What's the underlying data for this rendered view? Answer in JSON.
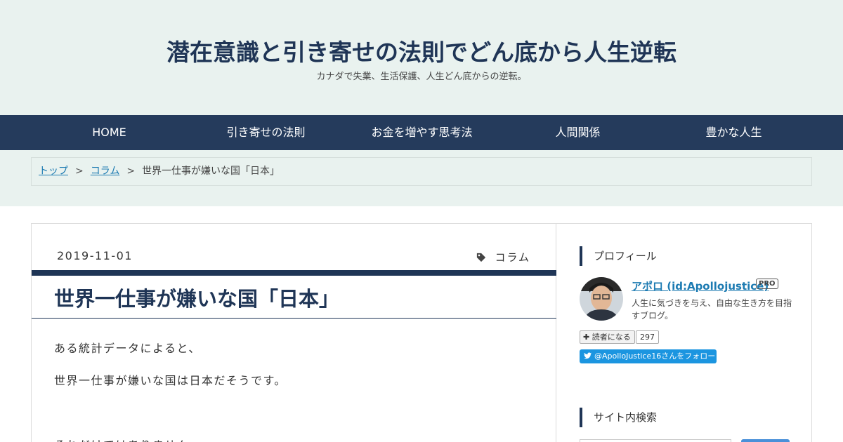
{
  "site": {
    "title": "潜在意識と引き寄せの法則でどん底から人生逆転",
    "description": "カナダで失業、生活保護、人生どん底からの逆転。"
  },
  "nav": {
    "items": [
      "HOME",
      "引き寄せの法則",
      "お金を増やす思考法",
      "人間関係",
      "豊かな人生"
    ]
  },
  "breadcrumb": {
    "top": "トップ",
    "category": "コラム",
    "current": "世界一仕事が嫌いな国「日本」",
    "separator": ">"
  },
  "entry": {
    "date": "2019-11-01",
    "category": "コラム",
    "title": "世界一仕事が嫌いな国「日本」",
    "paragraphs": [
      "ある統計データによると、",
      "世界一仕事が嫌いな国は日本だそうです。",
      "それだけではありません。"
    ]
  },
  "sidebar": {
    "profile_heading": "プロフィール",
    "profile_name": "アポロ (id:Apollojustice)",
    "pro_badge": "PRO",
    "profile_desc": "人生に気づきを与え、自由な生き方を目指すブログ。",
    "reader_button": "読者になる",
    "reader_count": "297",
    "twitter_follow": "@ApolloJustice16さんをフォロー",
    "search_heading": "サイト内検索"
  },
  "colors": {
    "accent": "#1f3556",
    "nav_bg": "#253b5c",
    "header_bg": "#e9f2ef",
    "link": "#1d7bb2",
    "twitter": "#1b95e0"
  }
}
